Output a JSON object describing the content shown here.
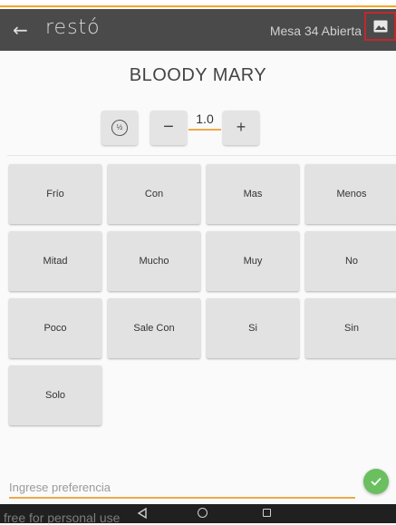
{
  "header": {
    "logo": "restó",
    "table_status": "Mesa 34  Abierta",
    "back_icon": "arrow-back-icon",
    "image_icon": "image-icon"
  },
  "product": {
    "name": "BLOODY MARY"
  },
  "quantity": {
    "value": "1.0",
    "half_label": "½",
    "minus_label": "−",
    "plus_label": "+"
  },
  "modifiers": [
    {
      "label": "Frío"
    },
    {
      "label": "Con"
    },
    {
      "label": "Mas"
    },
    {
      "label": "Menos"
    },
    {
      "label": "Mitad"
    },
    {
      "label": "Mucho"
    },
    {
      "label": "Muy"
    },
    {
      "label": "No"
    },
    {
      "label": "Poco"
    },
    {
      "label": "Sale Con"
    },
    {
      "label": "Si"
    },
    {
      "label": "Sin"
    },
    {
      "label": "Solo"
    }
  ],
  "preference": {
    "placeholder": "Ingrese preferencia"
  },
  "watermark": "free for personal use",
  "colors": {
    "appbar": "#4a4a4a",
    "accent": "#f0a848",
    "confirm": "#6abf5e",
    "highlight": "#c0282d"
  }
}
